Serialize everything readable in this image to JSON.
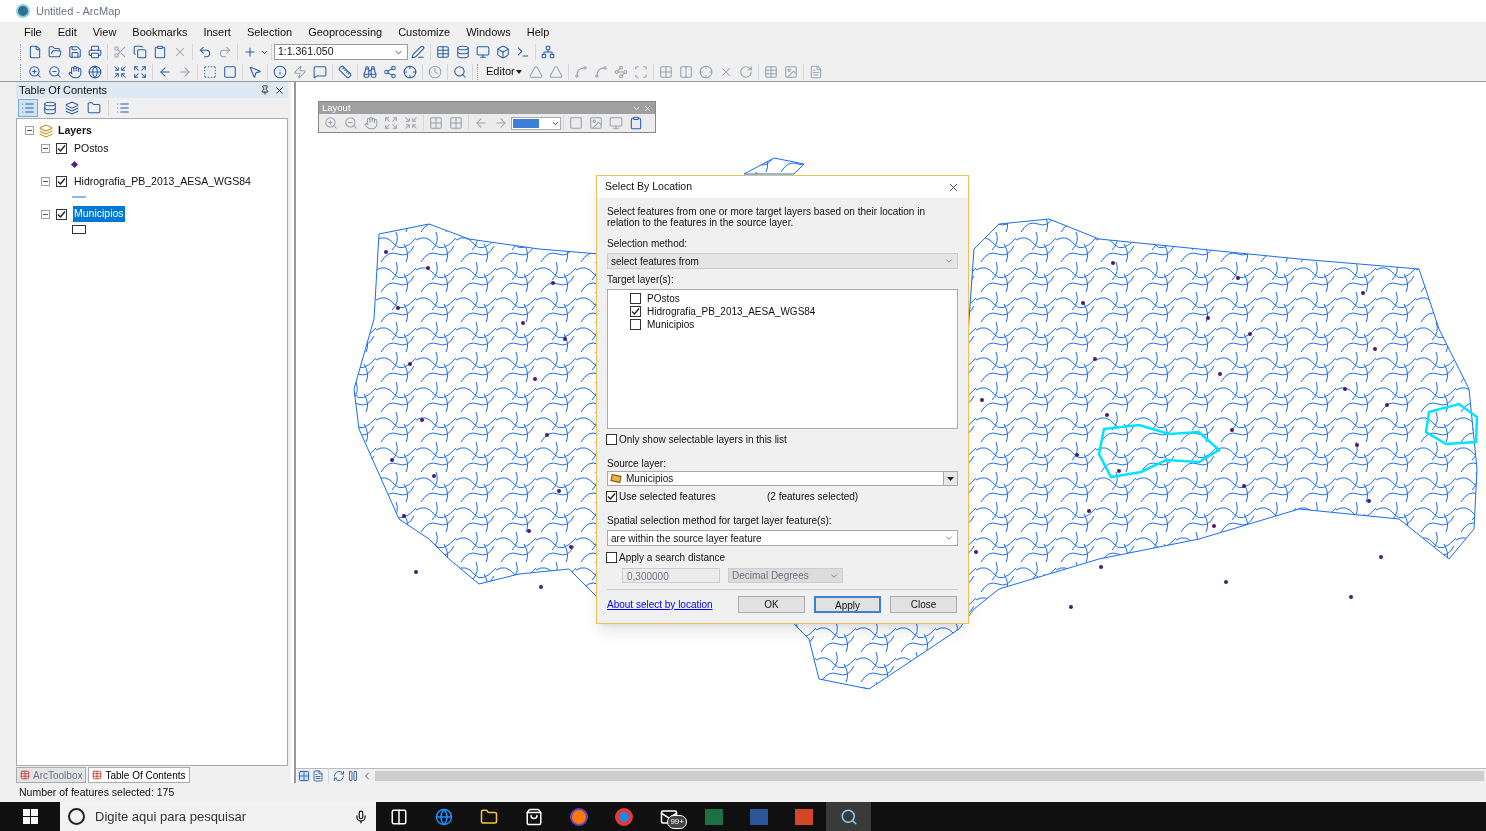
{
  "window": {
    "title": "Untitled - ArcMap"
  },
  "menu": [
    "File",
    "Edit",
    "View",
    "Bookmarks",
    "Insert",
    "Selection",
    "Geoprocessing",
    "Customize",
    "Windows",
    "Help"
  ],
  "toolbar": {
    "scale": "1:1.361.050",
    "editor": "Editor"
  },
  "toc": {
    "title": "Table Of Contents",
    "root": {
      "label": "Layers",
      "expanded": true,
      "children": [
        {
          "label": "POstos",
          "checked": true,
          "expanded": true,
          "selected": false,
          "kind": "point"
        },
        {
          "label": "Hidrografia_PB_2013_AESA_WGS84",
          "checked": true,
          "expanded": true,
          "selected": false,
          "kind": "line"
        },
        {
          "label": "Municipios",
          "checked": true,
          "expanded": true,
          "selected": true,
          "kind": "polygon"
        }
      ]
    }
  },
  "bottom_tabs": [
    {
      "label": "ArcToolbox",
      "selected": false
    },
    {
      "label": "Table Of Contents",
      "selected": true
    }
  ],
  "layout_toolbar": {
    "title": "Layout"
  },
  "dialog": {
    "title": "Select By Location",
    "description": "Select features from one or more target layers based on their location in relation to the features in the source layer.",
    "method_label": "Selection method:",
    "selection_method": "select features from",
    "target_label": "Target layer(s):",
    "targets": [
      {
        "label": "POstos",
        "checked": false
      },
      {
        "label": "Hidrografia_PB_2013_AESA_WGS84",
        "checked": true
      },
      {
        "label": "Municipios",
        "checked": false
      }
    ],
    "only_selectable": {
      "label": "Only show selectable layers in this list",
      "checked": false
    },
    "source_label": "Source layer:",
    "source": "Municipios",
    "use_selected": {
      "label": "Use selected features",
      "checked": true
    },
    "selected_count": "(2 features selected)",
    "spatial_label": "Spatial selection method for target layer feature(s):",
    "spatial_method": "are within the source layer feature",
    "search_distance": {
      "label": "Apply a search distance",
      "checked": false,
      "value": "0,300000",
      "unit": "Decimal Degrees"
    },
    "link": "About select by location",
    "buttons": [
      {
        "label": "OK",
        "default": false
      },
      {
        "label": "Apply",
        "default": true
      },
      {
        "label": "Close",
        "default": false
      }
    ]
  },
  "status_bar": "Number of features selected: 175",
  "taskbar": {
    "search_placeholder": "Digite aqui para pesquisar",
    "badge": "99+"
  }
}
